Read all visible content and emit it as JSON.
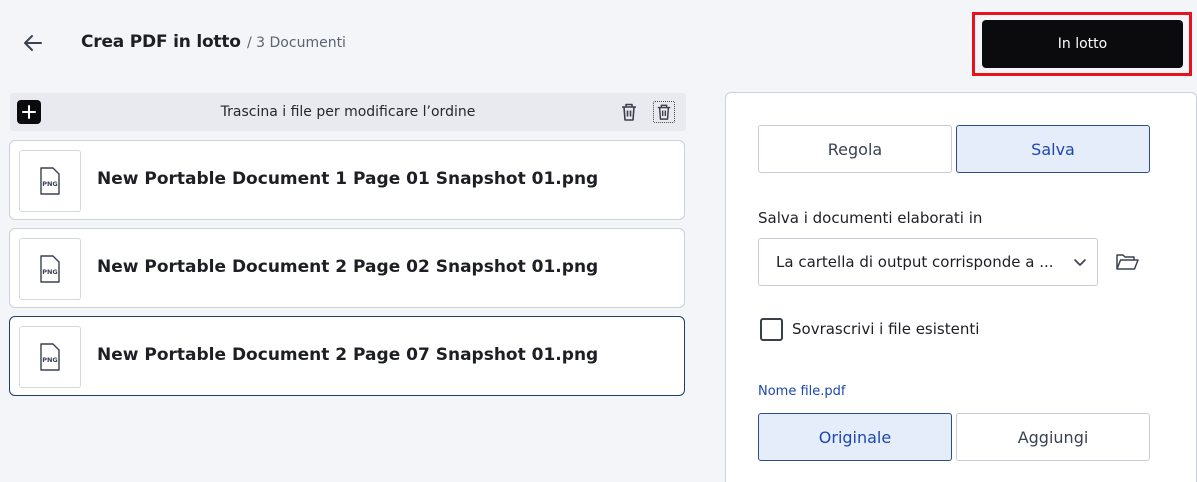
{
  "header": {
    "title": "Crea PDF in lotto",
    "subtitle": "/ 3 Documenti",
    "batch_button": "In lotto"
  },
  "toolbar": {
    "hint": "Trascina i file per modificare l’ordine"
  },
  "files": [
    {
      "name": "New Portable Document 1 Page 01 Snapshot 01.png",
      "thumb": "PNG"
    },
    {
      "name": "New Portable Document 2 Page 02 Snapshot 01.png",
      "thumb": "PNG"
    },
    {
      "name": "New Portable Document 2 Page 07 Snapshot 01.png",
      "thumb": "PNG"
    }
  ],
  "panel": {
    "tabs": [
      {
        "label": "Regola"
      },
      {
        "label": "Salva"
      }
    ],
    "save_label": "Salva i documenti elaborati in",
    "output_select": "La cartella di output corrisponde a ...",
    "overwrite_label": "Sovrascrivi i file esistenti",
    "filename_label": "Nome file.pdf",
    "naming": [
      {
        "label": "Originale"
      },
      {
        "label": "Aggiungi"
      }
    ]
  },
  "colors": {
    "accent": "#1c47b0",
    "primary_button": "#0b0b0d",
    "highlight_outline": "#e8121e"
  },
  "icons": [
    "arrow-left-icon",
    "plus-icon",
    "trash-icon",
    "trash-dotted-icon",
    "png-file-icon",
    "chevron-down-icon",
    "folder-open-icon"
  ]
}
